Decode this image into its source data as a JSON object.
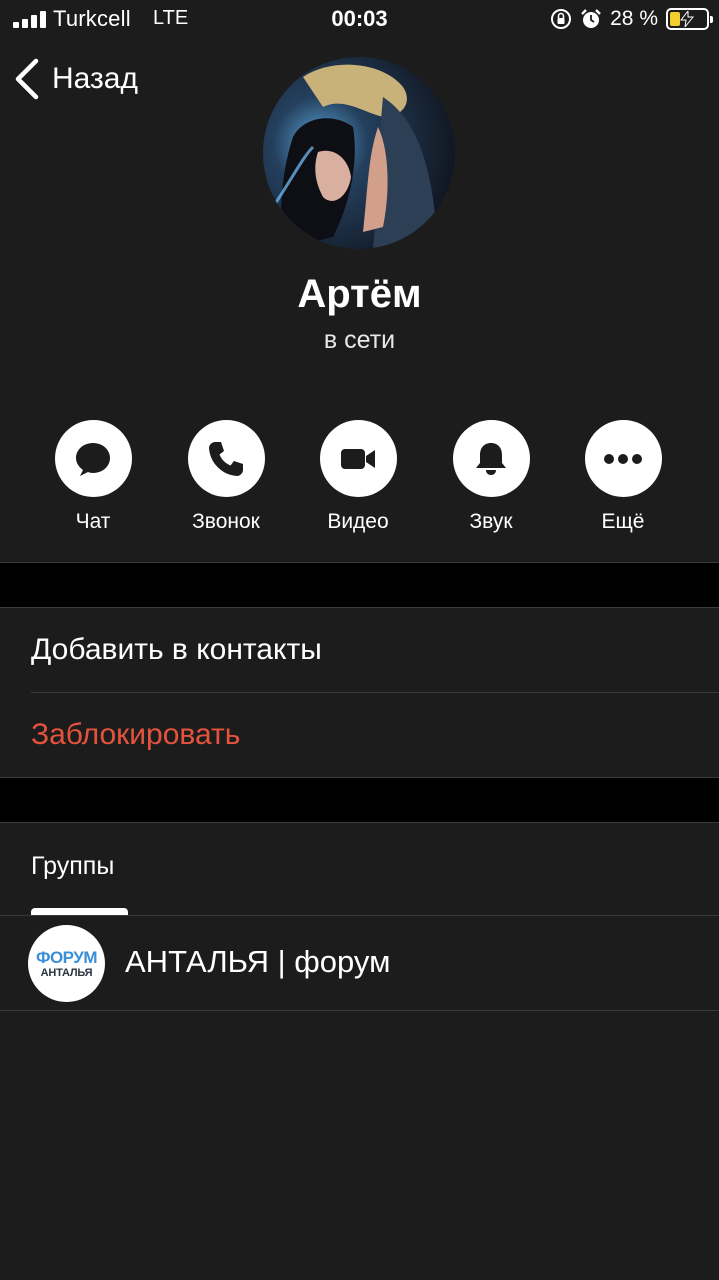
{
  "status_bar": {
    "carrier": "Turkcell",
    "network": "LTE",
    "time": "00:03",
    "battery_text": "28 %",
    "battery_level": 0.28,
    "icons": [
      "signal-icon",
      "rotation-lock-icon",
      "alarm-icon",
      "battery-charging-icon"
    ]
  },
  "header": {
    "back_label": "Назад"
  },
  "profile": {
    "name": "Артём",
    "presence": "в сети"
  },
  "actions": [
    {
      "label": "Чат",
      "icon": "chat-bubble-icon"
    },
    {
      "label": "Звонок",
      "icon": "phone-icon"
    },
    {
      "label": "Видео",
      "icon": "video-camera-icon"
    },
    {
      "label": "Звук",
      "icon": "bell-icon"
    },
    {
      "label": "Ещё",
      "icon": "more-dots-icon"
    }
  ],
  "contact_actions": {
    "add_contact": "Добавить в контакты",
    "block": "Заблокировать"
  },
  "groups": {
    "header": "Группы",
    "items": [
      {
        "name": "АНТАЛЬЯ | форум",
        "logo_top": "ФОРУМ",
        "logo_bottom": "АНТАЛЬЯ"
      }
    ]
  },
  "colors": {
    "background": "#1c1c1d",
    "separator": "#000000",
    "destructive": "#e5533d",
    "accent_white": "#ffffff",
    "battery": "#f2cd2c"
  }
}
